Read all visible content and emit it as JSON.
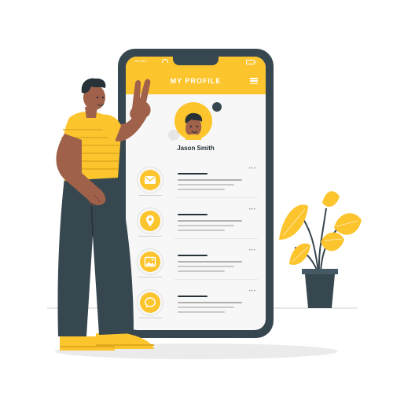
{
  "app": {
    "title": "MY PROFILE",
    "status_dots": "•••••"
  },
  "profile": {
    "name": "Jason Smith"
  },
  "rows": [
    {
      "icon": "mail-icon",
      "more": "•••"
    },
    {
      "icon": "location-pin-icon",
      "more": "•••"
    },
    {
      "icon": "image-icon",
      "more": "•••"
    },
    {
      "icon": "chat-bubble-icon",
      "more": "•••"
    }
  ],
  "colors": {
    "accent": "#fcc42d",
    "dark": "#37474f",
    "skin": "#a0614a",
    "plant_leaf": "#fcc42d",
    "pot": "#37474f"
  }
}
